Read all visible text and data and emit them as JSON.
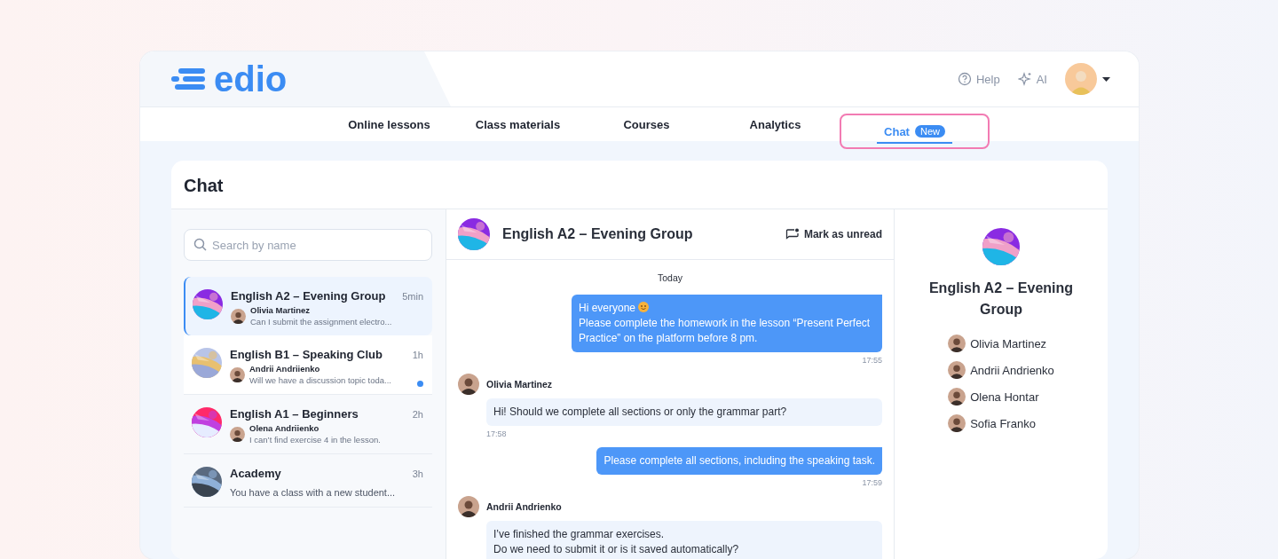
{
  "header": {
    "logo": "edio",
    "links": [
      {
        "label": "Help",
        "kind": "help"
      },
      {
        "label": "AI",
        "kind": "ai"
      }
    ]
  },
  "nav": {
    "tabs": [
      {
        "label": "Online lessons",
        "selected": false
      },
      {
        "label": "Class materials",
        "selected": false
      },
      {
        "label": "Courses",
        "selected": false
      },
      {
        "label": "Analytics",
        "selected": false
      },
      {
        "label": "Chat",
        "selected": true,
        "badge": "New"
      }
    ]
  },
  "page_title": "Chat",
  "search": {
    "placeholder": "Search by name"
  },
  "chats": [
    {
      "name": "English A2 – Evening Group",
      "time": "5min",
      "sender": "Olivia Martinez",
      "preview": "Can I submit the assignment electro...",
      "selected": true,
      "unread": false
    },
    {
      "name": "English B1 – Speaking Club",
      "time": "1h",
      "sender": "Andrii Andriienko",
      "preview": "Will we have a discussion topic toda...",
      "selected": false,
      "unread": true
    },
    {
      "name": "English A1 – Beginners",
      "time": "2h",
      "sender": "Olena Andriienko",
      "preview": "I can’t find exercise 4 in the lesson.",
      "selected": false,
      "unread": false
    },
    {
      "name": "Academy",
      "time": "3h",
      "preview": "You have a class with a new student...",
      "selected": false,
      "unread": false
    }
  ],
  "conversation": {
    "title": "English A2 – Evening Group",
    "mark_unread": "Mark as unread",
    "day": "Today",
    "messages": [
      {
        "kind": "outgoing",
        "lines": [
          "Hi everyone",
          "Please complete the homework in the lesson “Present Perfect Practice” on the platform before 8 pm."
        ],
        "emoji": true,
        "time": "17:55"
      },
      {
        "kind": "incoming",
        "sender": "Olivia Martinez",
        "lines": [
          "Hi! Should we complete all sections or only the grammar part?"
        ],
        "time": "17:58"
      },
      {
        "kind": "outgoing",
        "lines": [
          "Please complete all sections, including the speaking task."
        ],
        "time": "17:59"
      },
      {
        "kind": "incoming",
        "sender": "Andrii Andrienko",
        "lines": [
          "I’ve finished the grammar exercises.",
          "Do we need to submit it or is it saved automatically?"
        ]
      }
    ]
  },
  "info": {
    "title": "English A2 – Evening Group",
    "members": [
      "Olivia Martinez",
      "Andrii Andrienko",
      "Olena Hontar",
      "Sofia Franko"
    ]
  }
}
